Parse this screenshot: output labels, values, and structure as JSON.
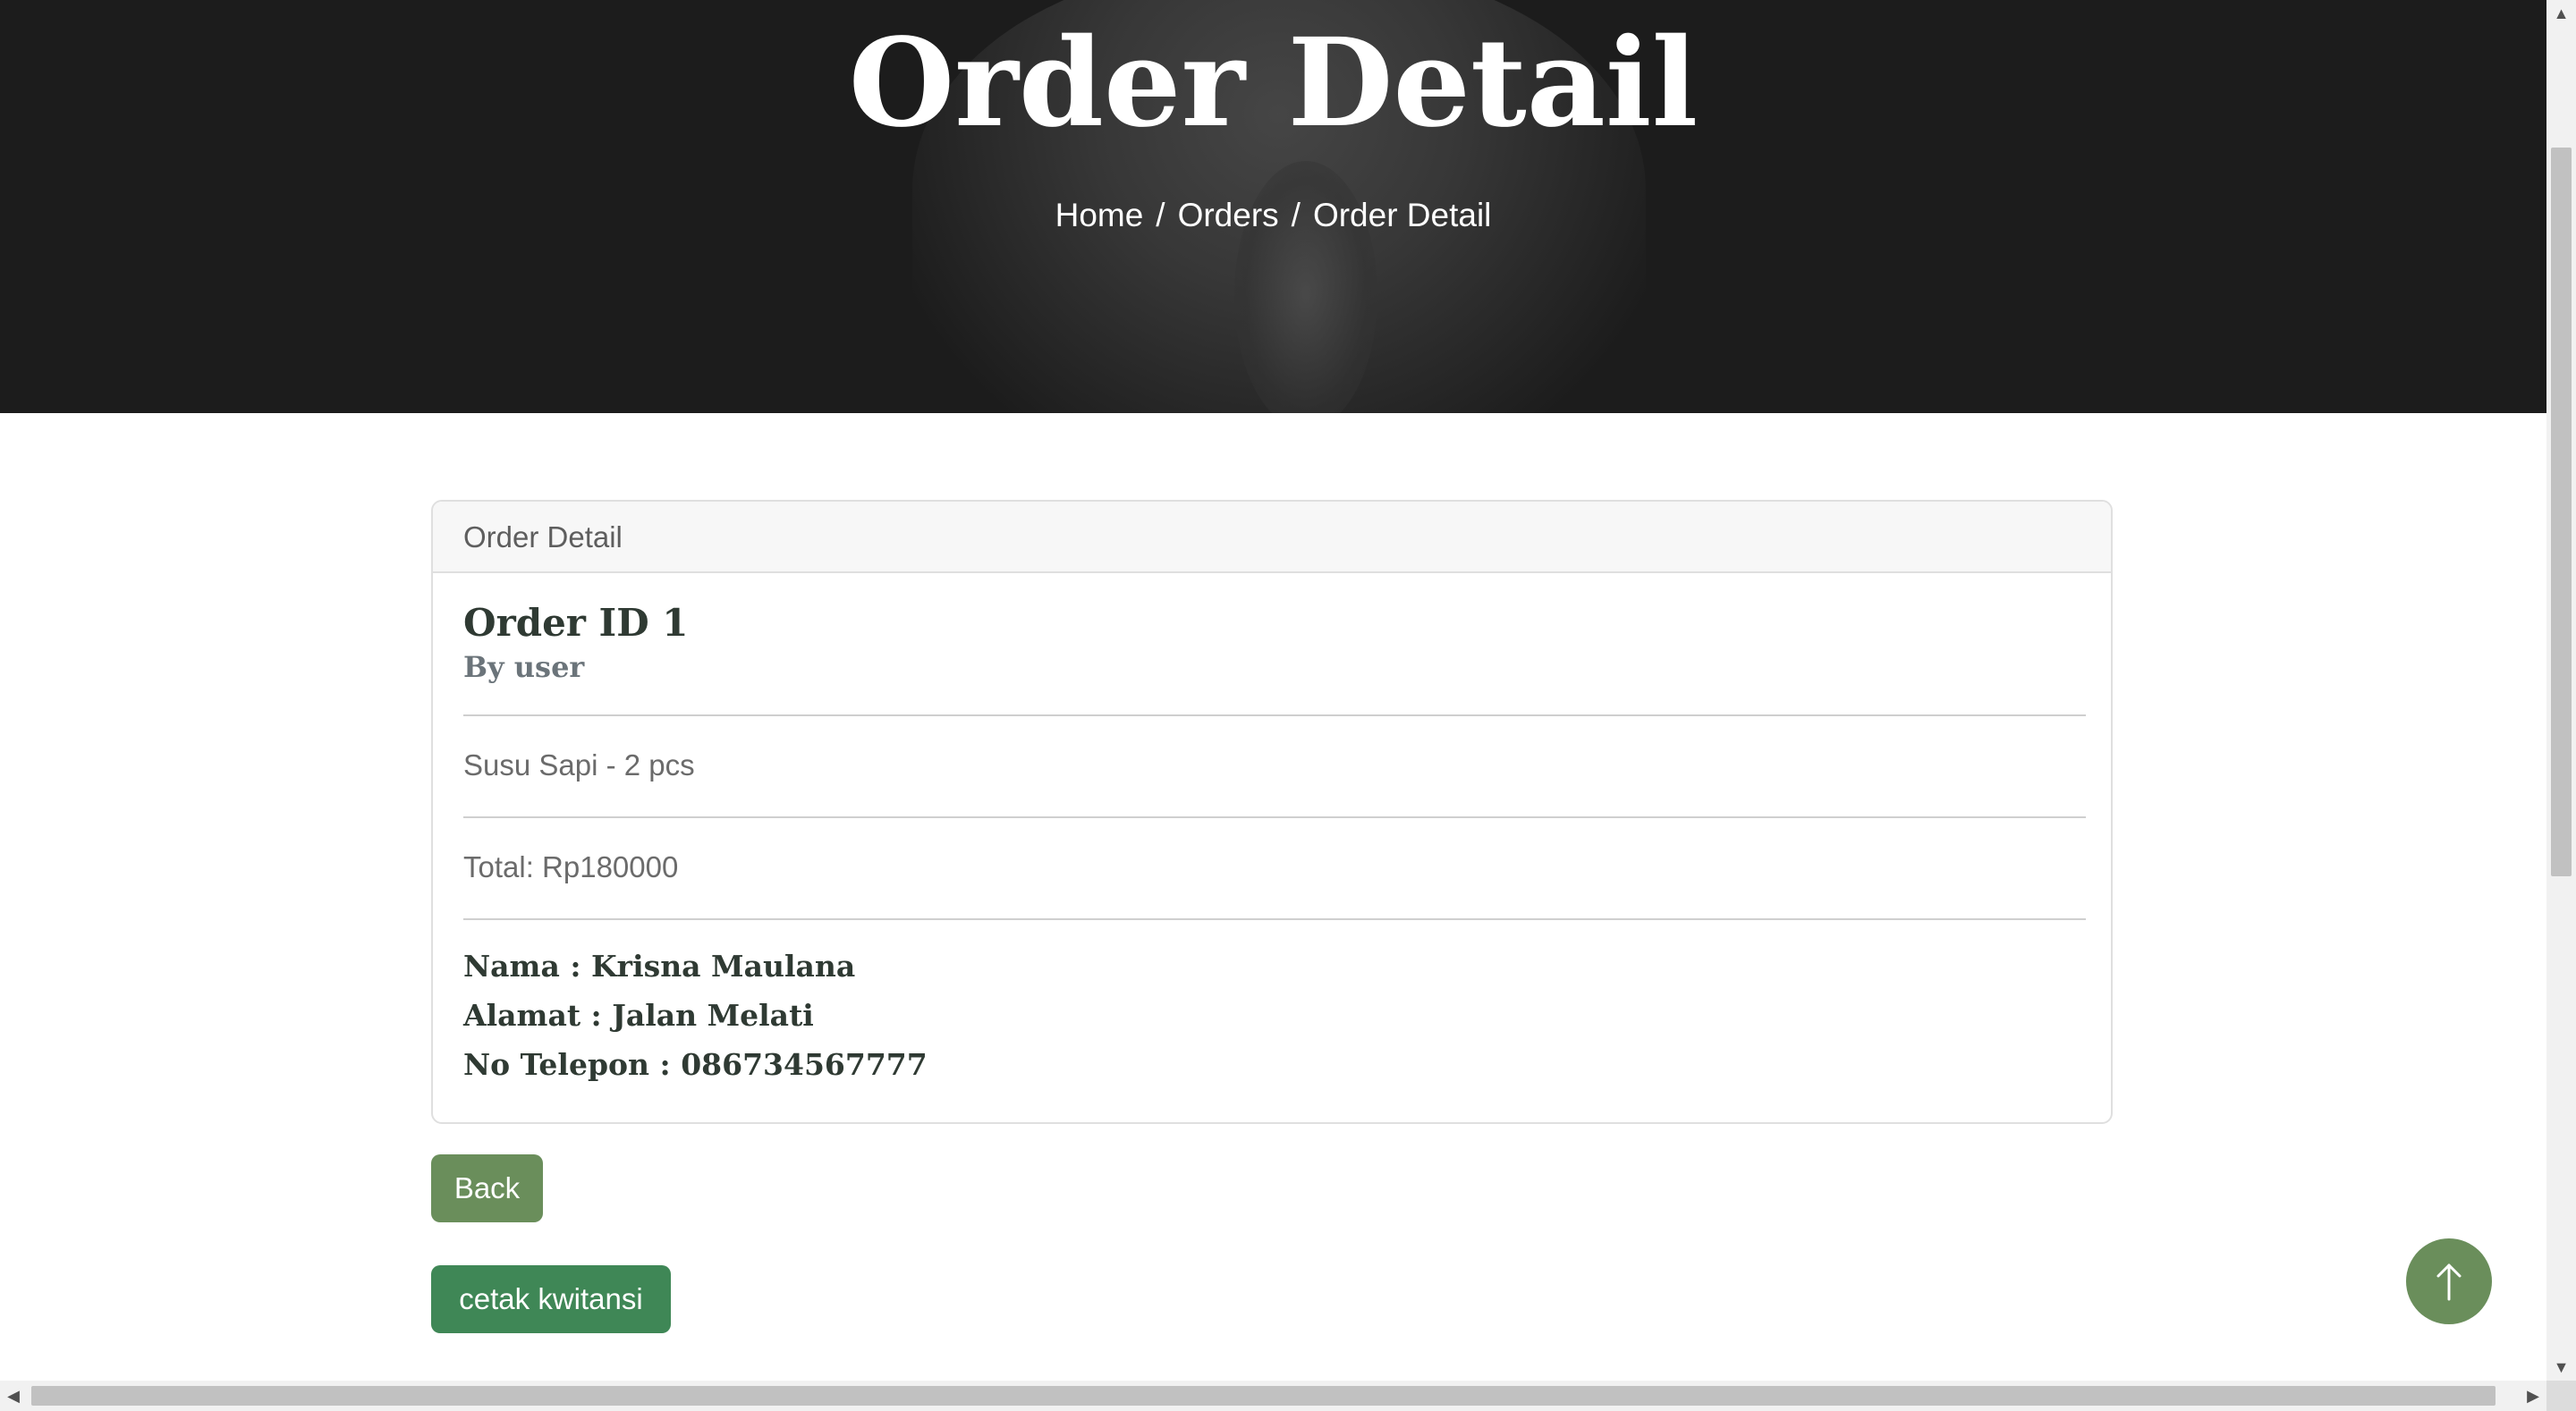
{
  "hero": {
    "title": "Order Detail",
    "breadcrumb": [
      {
        "label": "Home"
      },
      {
        "label": "Orders"
      },
      {
        "label": "Order Detail"
      }
    ],
    "separator": "/"
  },
  "card": {
    "header": "Order Detail",
    "order_id": "Order ID 1",
    "by": "By user",
    "item": "Susu Sapi - 2 pcs",
    "total": "Total: Rp180000",
    "nama": "Nama : Krisna Maulana",
    "alamat": "Alamat : Jalan Melati",
    "telepon": "No Telepon : 086734567777"
  },
  "actions": {
    "back_label": "Back",
    "print_label": "cetak kwitansi"
  },
  "icons": {
    "scroll_top": "arrow-up-icon"
  },
  "colors": {
    "primary": "#6a8e5b",
    "print_button": "#3f8756",
    "hero_bg": "#1c1c1c"
  }
}
